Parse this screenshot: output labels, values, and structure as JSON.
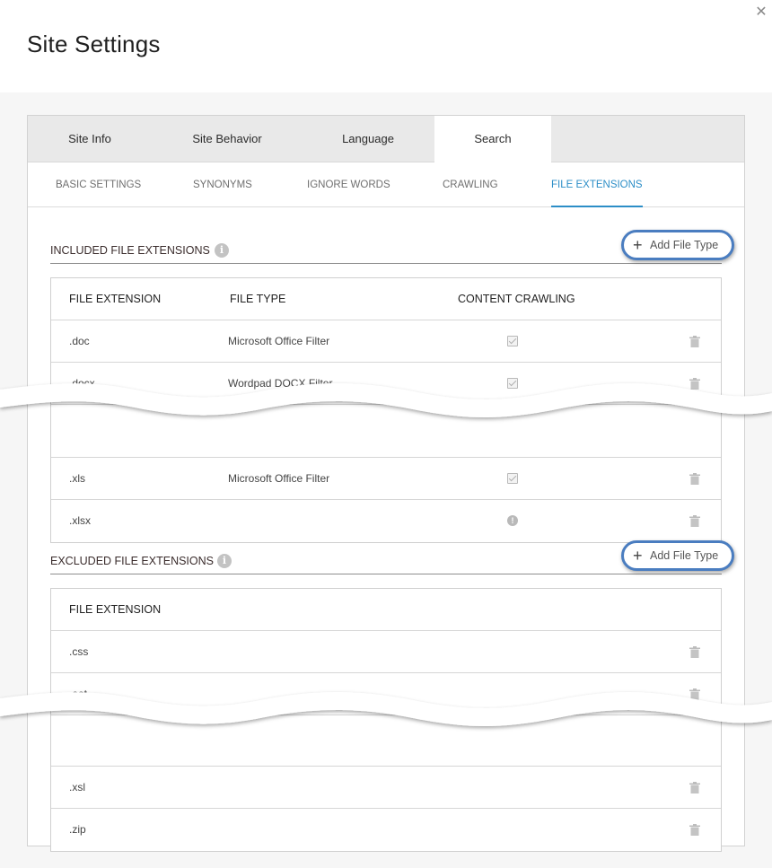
{
  "dialog": {
    "title": "Site Settings",
    "close_glyph": "✕"
  },
  "main_tabs": [
    "Site Info",
    "Site Behavior",
    "Language",
    "Search"
  ],
  "sub_tabs": [
    "BASIC SETTINGS",
    "SYNONYMS",
    "IGNORE WORDS",
    "CRAWLING",
    "FILE EXTENSIONS"
  ],
  "included": {
    "title": "INCLUDED FILE EXTENSIONS",
    "add_label": "Add File Type",
    "columns": [
      "FILE EXTENSION",
      "FILE TYPE",
      "CONTENT CRAWLING"
    ],
    "rows": [
      {
        "ext": ".doc",
        "type": "Microsoft Office Filter",
        "crawl": "check"
      },
      {
        "ext": ".docx",
        "type": "Wordpad DOCX Filter",
        "crawl": "check"
      },
      {
        "ext": ".xls",
        "type": "Microsoft Office Filter",
        "crawl": "check"
      },
      {
        "ext": ".xlsx",
        "type": "",
        "crawl": "alert"
      }
    ]
  },
  "excluded": {
    "title": "EXCLUDED FILE EXTENSIONS",
    "add_label": "Add File Type",
    "columns": [
      "FILE EXTENSION"
    ],
    "rows": [
      {
        "ext": ".css"
      },
      {
        "ext": ".eot"
      },
      {
        "ext": ".xsl"
      },
      {
        "ext": ".zip"
      }
    ]
  },
  "icons": {
    "info": "info-icon",
    "add": "plus-icon",
    "delete": "trash-icon",
    "checked": "checkbox-checked-icon",
    "warning": "alert-circle-icon",
    "close": "close-icon"
  },
  "colors": {
    "accent": "#2c8ec7",
    "highlight_ring": "#4a7dc0",
    "tab_bar": "#e9e9e9"
  }
}
